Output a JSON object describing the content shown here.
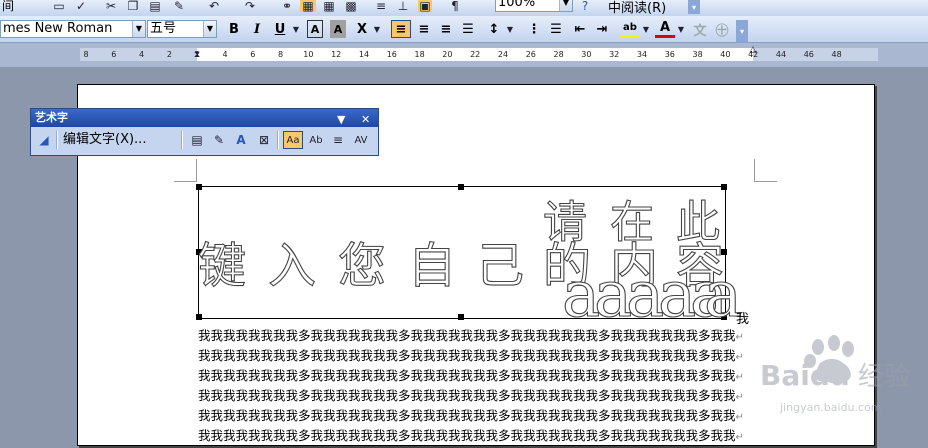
{
  "toolbar_standard": {
    "menu_fragment": "间",
    "zoom": "100%",
    "reading_mode": "中阅读(R)"
  },
  "toolbar_format": {
    "font_name": "mes New Roman",
    "font_size": "五号",
    "bold": "B",
    "italic": "I",
    "underline": "U",
    "char_border": "A",
    "char_shade": "A",
    "char_scale": "X"
  },
  "ruler": {
    "ticks": [
      "8",
      "6",
      "4",
      "2",
      "2",
      "4",
      "6",
      "8",
      "10",
      "12",
      "14",
      "16",
      "18",
      "20",
      "22",
      "24",
      "26",
      "28",
      "30",
      "32",
      "34",
      "36",
      "38",
      "40",
      "42",
      "44",
      "46",
      "48"
    ]
  },
  "wordart_toolbar": {
    "title": "艺术字",
    "edit_text": "编辑文字(X)...",
    "same_height": "Aa",
    "spacing": "AV"
  },
  "wordart": {
    "line1_chars": [
      "请",
      "在",
      "此"
    ],
    "line2_chars": [
      "键",
      "入",
      "您",
      "自",
      "己",
      "的",
      "内",
      "容"
    ],
    "line3_chars": [
      "a",
      "a",
      "a",
      "a",
      "a",
      "a"
    ],
    "trailing_char": "我"
  },
  "body_lines": [
    "我我我我我我我我多我我我我我我我多我我我我我我我多我我我我我我我多我我我我我我我多我我",
    "我我我我我我我我多我我我我我我我多我我我我我我我多我我我我我我我多我我我我我我我多我我",
    "我我我我我我我我多我我我我我我我多我我我我我我我多我我我我我我我多我我我我我我我多我我",
    "我我我我我我我我多我我我我我我我多我我我我我我我多我我我我我我我多我我我我我我我多我我",
    "我我我我我我我我多我我我我我我我多我我我我我我我多我我我我我我我多我我我我我我我多我我",
    "我我我我我我我我多我我我我我我我多我我我我我我我多我我我我我我我多我我我我我我我多我我"
  ],
  "return_mark": "↵",
  "watermark": {
    "brand": "Baidu",
    "tag": "经验",
    "site": "jingyan.baidu.com"
  },
  "colors": {
    "toolbar_top": "#e6eefb",
    "toolbar_bottom": "#c3d4ee",
    "workspace": "#8d97ab",
    "active_button": "#f7c86a",
    "titlebar": "#2a56b8"
  }
}
